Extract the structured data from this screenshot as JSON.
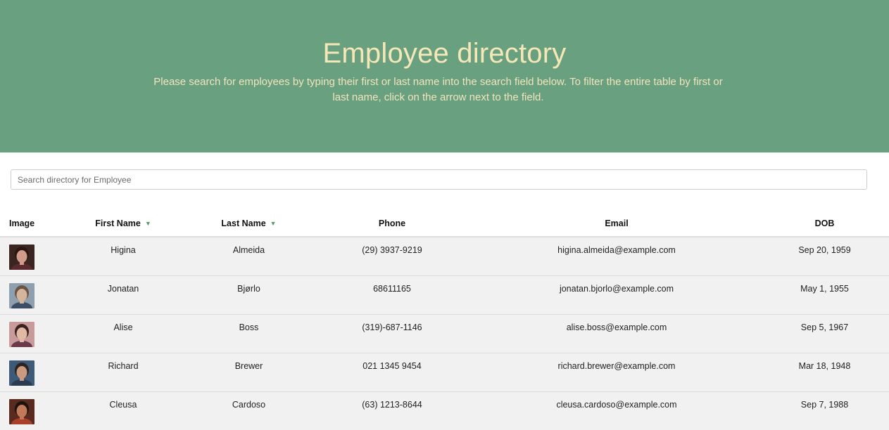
{
  "header": {
    "title": "Employee directory",
    "lead": "Please search for employees by typing their first or last name into the search field below. To filter the entire table by first or last name, click on the arrow next to the field."
  },
  "search": {
    "placeholder": "Search directory for Employee",
    "value": ""
  },
  "table": {
    "columns": {
      "image": "Image",
      "first_name": "First Name",
      "last_name": "Last Name",
      "phone": "Phone",
      "email": "Email",
      "dob": "DOB"
    },
    "sort_icon": "triangle-down-icon",
    "rows": [
      {
        "first": "Higina",
        "last": "Almeida",
        "phone": "(29) 3937-9219",
        "email": "higina.almeida@example.com",
        "dob": "Sep 20, 1959",
        "avatar": {
          "bg": "#3a2520",
          "skin": "#d29c8a",
          "hair": "#2a1713",
          "shirt": "#5a2a2e"
        }
      },
      {
        "first": "Jonatan",
        "last": "Bjørlo",
        "phone": "68611165",
        "email": "jonatan.bjorlo@example.com",
        "dob": "May 1, 1955",
        "avatar": {
          "bg": "#8ea0b0",
          "skin": "#d4b49a",
          "hair": "#6b5443",
          "shirt": "#3c4d66"
        }
      },
      {
        "first": "Alise",
        "last": "Boss",
        "phone": "(319)-687-1146",
        "email": "alise.boss@example.com",
        "dob": "Sep 5, 1967",
        "avatar": {
          "bg": "#c89a9a",
          "skin": "#e2b9a4",
          "hair": "#3b2220",
          "shirt": "#6a3a4a"
        }
      },
      {
        "first": "Richard",
        "last": "Brewer",
        "phone": "021 1345 9454",
        "email": "richard.brewer@example.com",
        "dob": "Mar 18, 1948",
        "avatar": {
          "bg": "#3d5a78",
          "skin": "#c89a80",
          "hair": "#2c2220",
          "shirt": "#2b3b52"
        }
      },
      {
        "first": "Cleusa",
        "last": "Cardoso",
        "phone": "(63) 1213-8644",
        "email": "cleusa.cardoso@example.com",
        "dob": "Sep 7, 1988",
        "avatar": {
          "bg": "#5a2a1e",
          "skin": "#c07a5a",
          "hair": "#1e120e",
          "shirt": "#a8402a"
        }
      }
    ]
  }
}
